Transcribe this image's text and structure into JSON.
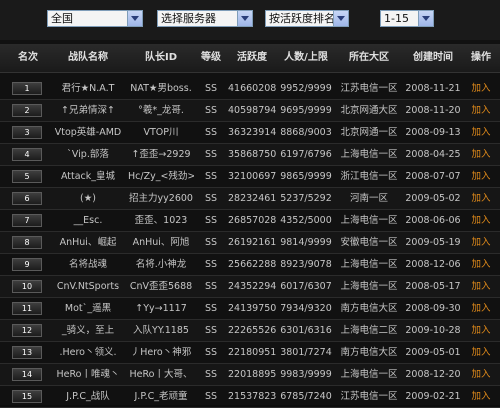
{
  "filters": [
    {
      "value": "全国"
    },
    {
      "value": "选择服务器"
    },
    {
      "value": "按活跃度排名"
    },
    {
      "value": "1-15"
    }
  ],
  "columns": [
    "名次",
    "战队名称",
    "队长ID",
    "等级",
    "活跃度",
    "人数/上限",
    "所在大区",
    "创建时间",
    "操作"
  ],
  "rows": [
    {
      "rank": "1",
      "team": "君行★N.A.T",
      "captain": "NAT★男boss.",
      "level": "SS",
      "activity": "41660208",
      "members": "9952/9999",
      "region": "江苏电信一区",
      "created": "2008-11-21",
      "action": "加入"
    },
    {
      "rank": "2",
      "team": "↑兄弟情深↑",
      "captain": "°羲*_龙哥.",
      "level": "SS",
      "activity": "40598794",
      "members": "9695/9999",
      "region": "北京网通大区",
      "created": "2008-11-20",
      "action": "加入"
    },
    {
      "rank": "3",
      "team": "Vtop英雄-AMD",
      "captain": "VTOP川",
      "level": "SS",
      "activity": "36323914",
      "members": "8868/9003",
      "region": "北京网通一区",
      "created": "2008-09-13",
      "action": "加入"
    },
    {
      "rank": "4",
      "team": "`Vip.部落",
      "captain": "↑歪歪→2929",
      "level": "SS",
      "activity": "35868750",
      "members": "6197/6796",
      "region": "上海电信一区",
      "created": "2008-04-25",
      "action": "加入"
    },
    {
      "rank": "5",
      "team": "Attack_皇城",
      "captain": "Hc/Zy_<残劲>",
      "level": "SS",
      "activity": "32100697",
      "members": "9865/9999",
      "region": "浙江电信一区",
      "created": "2008-07-07",
      "action": "加入"
    },
    {
      "rank": "6",
      "team": "(★)",
      "captain": "招主力yy2600",
      "level": "SS",
      "activity": "28232461",
      "members": "5237/5292",
      "region": "河南一区",
      "created": "2009-05-02",
      "action": "加入"
    },
    {
      "rank": "7",
      "team": "__Esc.",
      "captain": "歪歪、1023",
      "level": "SS",
      "activity": "26857028",
      "members": "4352/5000",
      "region": "上海电信一区",
      "created": "2008-06-06",
      "action": "加入"
    },
    {
      "rank": "8",
      "team": "AnHui、崛起",
      "captain": "AnHui、阿旭",
      "level": "SS",
      "activity": "26192161",
      "members": "9814/9999",
      "region": "安徽电信一区",
      "created": "2009-05-19",
      "action": "加入"
    },
    {
      "rank": "9",
      "team": "名将战魂",
      "captain": "名将.小神龙",
      "level": "SS",
      "activity": "25662288",
      "members": "8923/9078",
      "region": "上海电信一区",
      "created": "2008-12-06",
      "action": "加入"
    },
    {
      "rank": "10",
      "team": "CnV.NtSports",
      "captain": "CnV歪歪5688",
      "level": "SS",
      "activity": "24352294",
      "members": "6017/6307",
      "region": "上海电信一区",
      "created": "2008-05-17",
      "action": "加入"
    },
    {
      "rank": "11",
      "team": "Mot`_遥黑",
      "captain": "↑Yy→1117",
      "level": "SS",
      "activity": "24139750",
      "members": "7934/9320",
      "region": "南方电信大区",
      "created": "2008-09-30",
      "action": "加入"
    },
    {
      "rank": "12",
      "team": "_骑义，至上",
      "captain": "入队YY.1185",
      "level": "SS",
      "activity": "22265526",
      "members": "6301/6316",
      "region": "上海电信二区",
      "created": "2009-10-28",
      "action": "加入"
    },
    {
      "rank": "13",
      "team": ".Hero丶领义.",
      "captain": "丿Hero丶神邪",
      "level": "SS",
      "activity": "22180951",
      "members": "3801/7274",
      "region": "南方电信大区",
      "created": "2009-05-01",
      "action": "加入"
    },
    {
      "rank": "14",
      "team": "HeRo丨唯魂丶",
      "captain": "HeRo丨大哥、",
      "level": "SS",
      "activity": "22018895",
      "members": "9983/9999",
      "region": "上海电信一区",
      "created": "2008-12-20",
      "action": "加入"
    },
    {
      "rank": "15",
      "team": "J.P.C_战队",
      "captain": "J.P.C_老顽童",
      "level": "SS",
      "activity": "21537823",
      "members": "6785/7240",
      "region": "江苏电信一区",
      "created": "2009-02-21",
      "action": "加入"
    }
  ]
}
